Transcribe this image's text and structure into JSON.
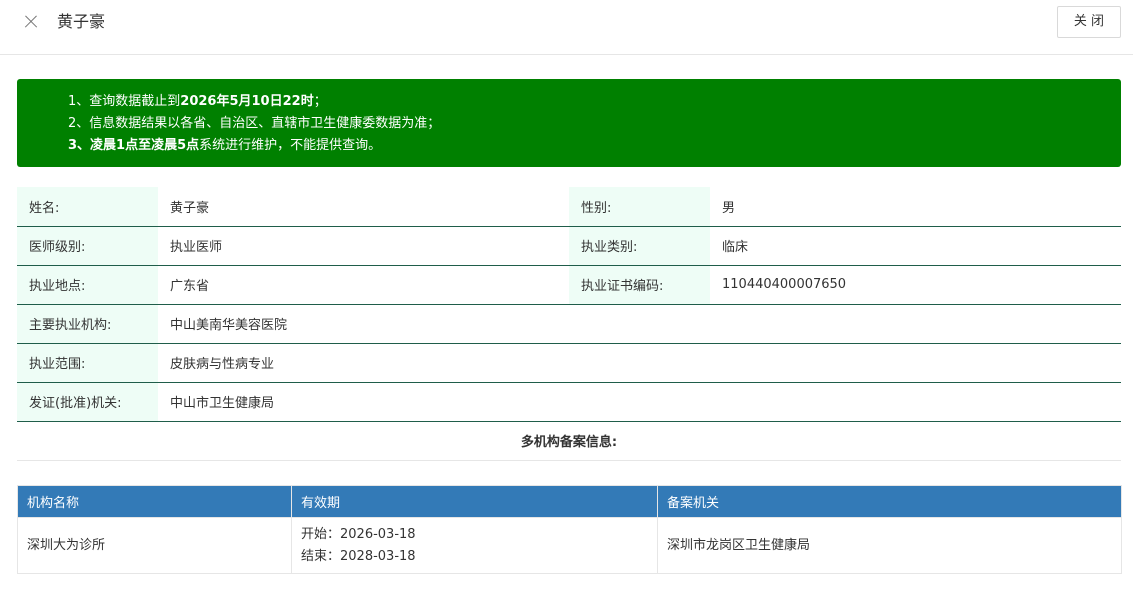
{
  "header": {
    "title": "黄子豪",
    "close_label": "关 闭"
  },
  "notice": {
    "line1_prefix": "1、查询数据截止到",
    "line1_bold": "2026年5月10日22时",
    "line1_suffix": "；",
    "line2": "2、信息数据结果以各省、自治区、直辖市卫生健康委数据为准；",
    "line3_prefix": "3、",
    "line3_bold1": "凌晨1点至凌晨5点",
    "line3_suffix": "系统进行维护，不能提供查询。",
    "bg_color": "#008000"
  },
  "info": {
    "name_label": "姓名:",
    "name": "黄子豪",
    "gender_label": "性别:",
    "gender": "男",
    "level_label": "医师级别:",
    "level": "执业医师",
    "category_label": "执业类别:",
    "category": "临床",
    "location_label": "执业地点:",
    "location": "广东省",
    "cert_label": "执业证书编码:",
    "cert": "110440400007650",
    "org_label": "主要执业机构:",
    "org": "中山美南华美容医院",
    "scope_label": "执业范围:",
    "scope": "皮肤病与性病专业",
    "issuer_label": "发证(批准)机关:",
    "issuer": "中山市卫生健康局",
    "multi_note": "多机构备案信息:"
  },
  "records": {
    "headers": [
      "机构名称",
      "有效期",
      "备案机关"
    ],
    "rows": [
      {
        "org": "深圳大为诊所",
        "start": "开始：2026-03-18",
        "end": "结束：2028-03-18",
        "authority": "深圳市龙岗区卫生健康局"
      }
    ],
    "header_color": "#337ab7"
  }
}
